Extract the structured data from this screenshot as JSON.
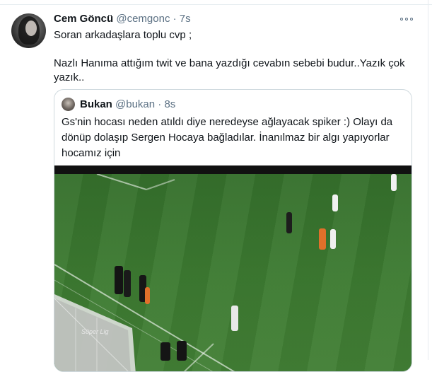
{
  "tweet": {
    "author_name": "Cem Göncü",
    "author_handle": "@cemgonc",
    "separator": "·",
    "time": "7s",
    "text_line1": "Soran arkadaşlara toplu cvp ;",
    "text_line2": "Nazlı Hanıma attığım twit ve bana yazdığı cevabın sebebi budur..Yazık çok yazık..",
    "more_icon": "ellipsis-icon"
  },
  "quote": {
    "author_name": "Bukan",
    "author_handle": "@bukan",
    "separator": "·",
    "time": "8s",
    "text": "Gs'nin hocası neden atıldı diye neredeyse ağlayacak spiker :) Olayı da dönüp dolaşıp Sergen Hocaya bağladılar. İnanılmaz bir algı yapıyorlar hocamız için",
    "video_watermark": "Süper Lig"
  },
  "colors": {
    "text": "#0f1419",
    "secondary": "#5b7083",
    "border": "#cfd9de",
    "pitch": "#3a7830"
  }
}
